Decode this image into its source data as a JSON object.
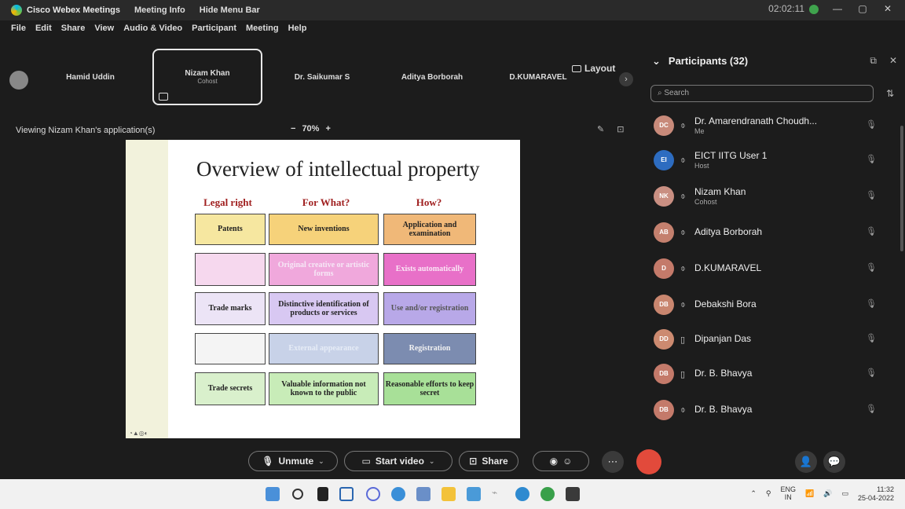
{
  "titlebar": {
    "app_name": "Cisco Webex Meetings",
    "meeting_info": "Meeting Info",
    "hide_menu": "Hide Menu Bar",
    "timer": "02:02:11"
  },
  "menu": [
    "File",
    "Edit",
    "Share",
    "View",
    "Audio & Video",
    "Participant",
    "Meeting",
    "Help"
  ],
  "strip": {
    "tiles": [
      {
        "name": "Hamid Uddin",
        "sub": ""
      },
      {
        "name": "Nizam Khan",
        "sub": "Cohost"
      },
      {
        "name": "Dr. Saikumar S",
        "sub": ""
      },
      {
        "name": "Aditya Borborah",
        "sub": ""
      },
      {
        "name": "D.KUMARAVEL",
        "sub": ""
      }
    ],
    "layout_label": "Layout"
  },
  "viewing_label": "Viewing Nizam Khan's application(s)",
  "zoom": {
    "minus": "−",
    "value": "70%",
    "plus": "+"
  },
  "slide": {
    "title": "Overview of intellectual property",
    "headers": [
      "Legal right",
      "For What?",
      "How?"
    ],
    "rows": [
      [
        "Patents",
        "New inventions",
        "Application and examination"
      ],
      [
        "",
        "Original creative or artistic forms",
        "Exists automatically"
      ],
      [
        "Trade marks",
        "Distinctive identification of products or services",
        "Use and/or registration"
      ],
      [
        "",
        "External appearance",
        "Registration"
      ],
      [
        "Trade secrets",
        "Valuable information not known to the public",
        "Reasonable efforts to keep secret"
      ]
    ],
    "colors": {
      "col1": [
        "#f6e7a0",
        "#f6d8ee",
        "#ece4f6",
        "#f4f4f4",
        "#d9f0cc"
      ],
      "col2": [
        "#f6d27a",
        "#f0a8dc",
        "#d8c8f2",
        "#c8d2e8",
        "#c8ecb8"
      ],
      "col3": [
        "#f0b878",
        "#e870c8",
        "#b8a8e8",
        "#7c8cb0",
        "#a8e098"
      ]
    }
  },
  "toolbar": {
    "unmute": "Unmute",
    "start_video": "Start video",
    "share": "Share"
  },
  "participants": {
    "header": "Participants (32)",
    "search_placeholder": "Search",
    "list": [
      {
        "initials": "DC",
        "name": "Dr. Amarendranath Choudh...",
        "role": "Me",
        "color": "#c88a7a"
      },
      {
        "initials": "EI",
        "name": "EICT IITG User 1",
        "role": "Host",
        "color": "#2d6cc0"
      },
      {
        "initials": "NK",
        "name": "Nizam Khan",
        "role": "Cohost",
        "color": "#c98f82"
      },
      {
        "initials": "AB",
        "name": "Aditya Borborah",
        "role": "",
        "color": "#c4806e"
      },
      {
        "initials": "D",
        "name": "D.KUMARAVEL",
        "role": "",
        "color": "#c47a6a"
      },
      {
        "initials": "DB",
        "name": "Debakshi Bora",
        "role": "",
        "color": "#c9866f"
      },
      {
        "initials": "DD",
        "name": "Dipanjan Das",
        "role": "",
        "color": "#cc8a70"
      },
      {
        "initials": "DB",
        "name": "Dr. B. Bhavya",
        "role": "",
        "color": "#c47a6a"
      },
      {
        "initials": "DB",
        "name": "Dr. B. Bhavya",
        "role": "",
        "color": "#c47a6a"
      }
    ]
  },
  "taskbar": {
    "lang_top": "ENG",
    "lang_bottom": "IN",
    "time": "11:32",
    "date": "25-04-2022"
  }
}
